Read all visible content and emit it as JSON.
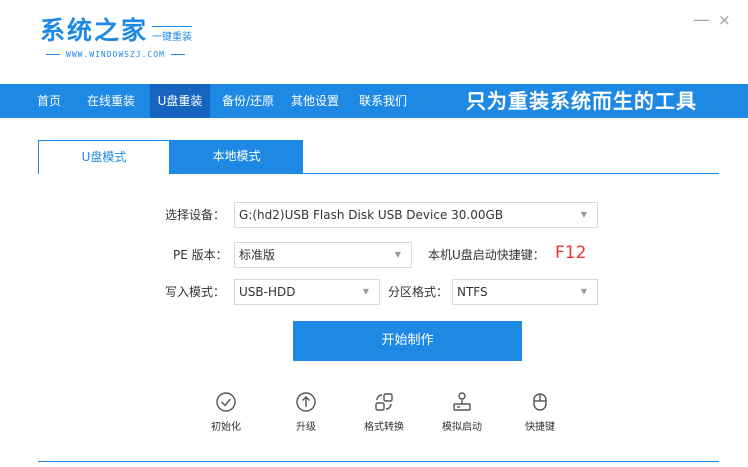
{
  "header": {
    "logo_title": "系统之家",
    "logo_sub": "一键重装",
    "logo_url": "WWW.WINDOWSZJ.COM",
    "minimize_label": "—",
    "close_label": "×"
  },
  "nav": {
    "items": [
      {
        "label": "首页",
        "active": false
      },
      {
        "label": "在线重装",
        "active": false
      },
      {
        "label": "U盘重装",
        "active": true
      },
      {
        "label": "备份/还原",
        "active": false
      },
      {
        "label": "其他设置",
        "active": false
      },
      {
        "label": "联系我们",
        "active": false
      }
    ],
    "slogan": "只为重装系统而生的工具"
  },
  "tabs": {
    "usb_mode": "U盘模式",
    "local_mode": "本地模式"
  },
  "form": {
    "device_label": "选择设备：",
    "device_value": "G:(hd2)USB Flash Disk USB Device 30.00GB",
    "pe_label": "PE 版本：",
    "pe_value": "标准版",
    "hotkey_label": "本机U盘启动快捷键：",
    "hotkey_value": "F12",
    "write_label": "写入模式：",
    "write_value": "USB-HDD",
    "partition_label": "分区格式：",
    "partition_value": "NTFS",
    "dropdown_arrow": "▼"
  },
  "start_button": "开始制作",
  "tools": [
    {
      "label": "初始化",
      "icon": "check-circle-icon"
    },
    {
      "label": "升级",
      "icon": "arrow-up-circle-icon"
    },
    {
      "label": "格式转换",
      "icon": "convert-icon"
    },
    {
      "label": "模拟启动",
      "icon": "joystick-icon"
    },
    {
      "label": "快捷键",
      "icon": "mouse-icon"
    }
  ],
  "colors": {
    "primary": "#1e88e5",
    "nav_active": "#1565c0",
    "hotkey": "#e53935"
  }
}
